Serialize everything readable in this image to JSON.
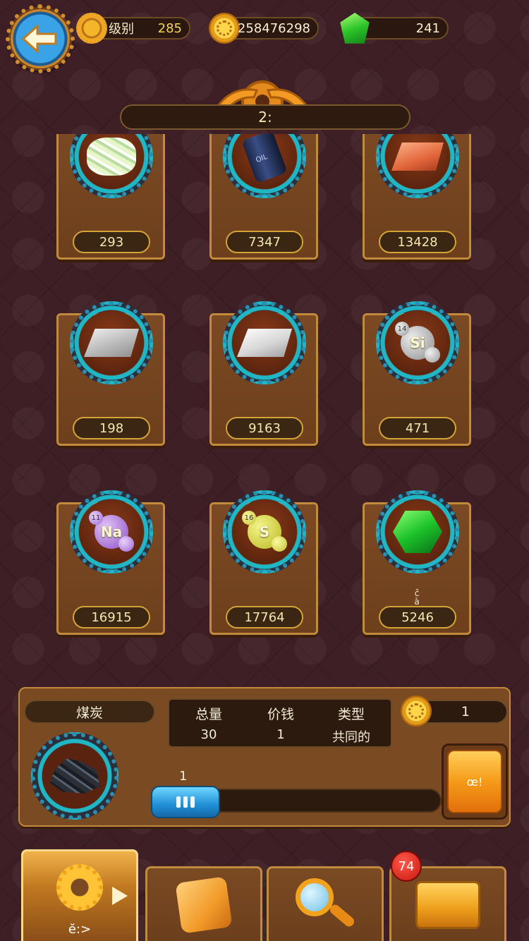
{
  "top_bar": {
    "level_label": "级别",
    "level_value": "285",
    "gold_value": "258476298",
    "gem_value": "241"
  },
  "title": "2:",
  "items": [
    {
      "icon": "crystal-ore-icon",
      "count": "293"
    },
    {
      "icon": "oil-barrel-icon",
      "count": "7347"
    },
    {
      "icon": "copper-ingot-icon",
      "count": "13428"
    },
    {
      "icon": "silver-ingot-icon",
      "count": "198"
    },
    {
      "icon": "platinum-ingot-icon",
      "count": "9163"
    },
    {
      "icon": "silicon-atom-icon",
      "count": "471",
      "symbol": "Si",
      "number": "14"
    },
    {
      "icon": "sodium-atom-icon",
      "count": "16915",
      "symbol": "Na",
      "number": "11"
    },
    {
      "icon": "sulfur-atom-icon",
      "count": "17764",
      "symbol": "S",
      "number": "16"
    },
    {
      "icon": "emerald-icon",
      "count": "5246",
      "sub": "č\nà"
    }
  ],
  "detail": {
    "name": "煤炭",
    "icon": "coal-icon",
    "total_label": "总量",
    "total_value": "30",
    "price_label": "价钱",
    "price_value": "1",
    "type_label": "类型",
    "type_value": "共同的",
    "sell_price": "1",
    "quantity": "1",
    "sell_label": "œ!"
  },
  "nav": {
    "settings_label": "ĕ:>",
    "badge_count": "74"
  }
}
